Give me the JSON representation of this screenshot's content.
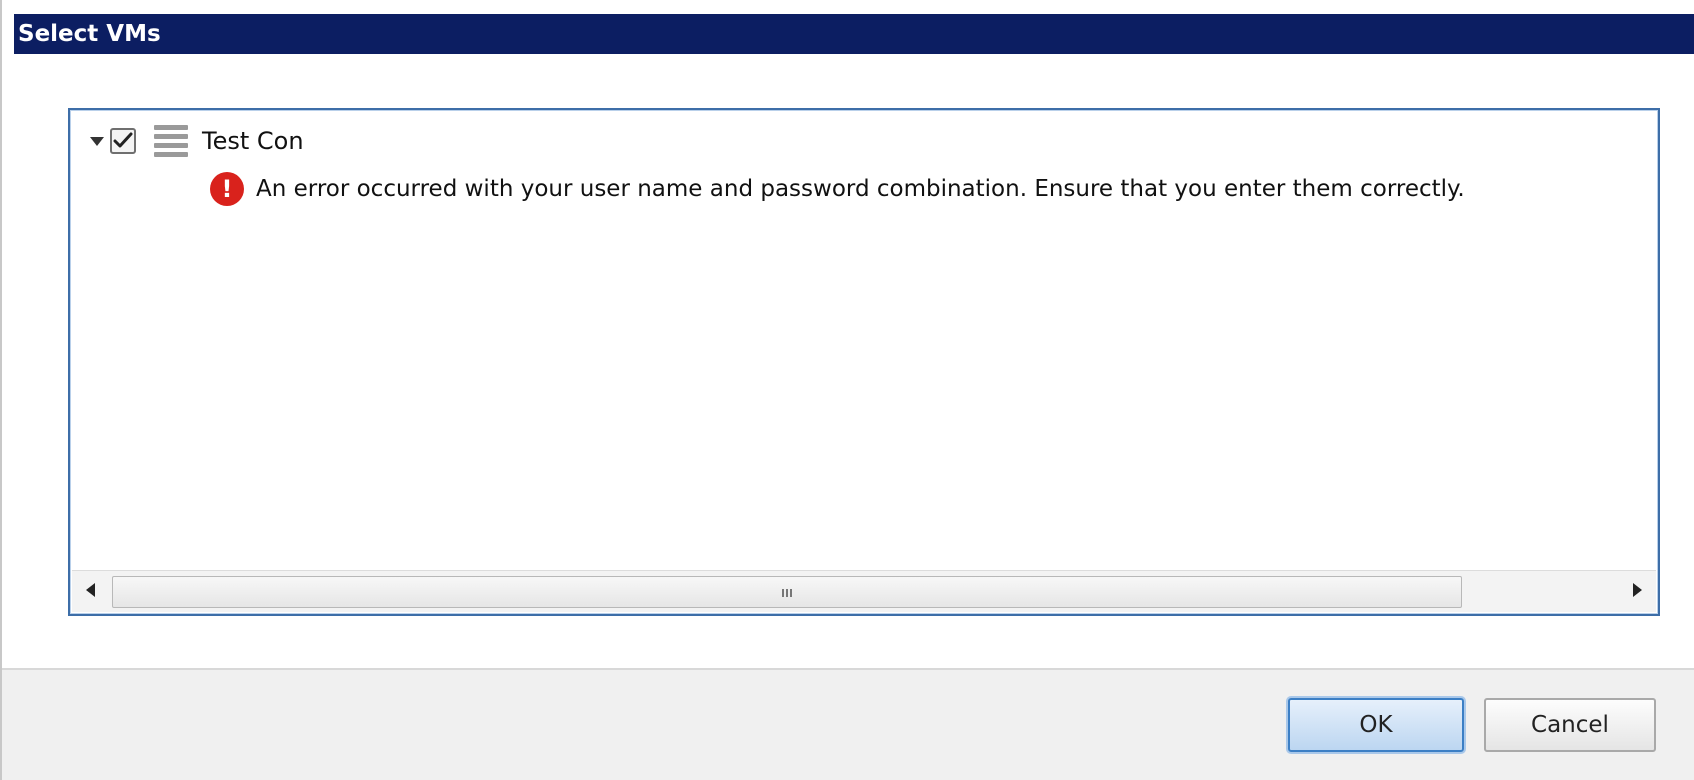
{
  "dialog": {
    "title": "Select VMs"
  },
  "tree": {
    "items": [
      {
        "label": "Test Con",
        "checked": true,
        "expanded": true,
        "icon": "server-icon",
        "error": {
          "icon": "error-icon",
          "icon_glyph": "!",
          "message": "An error occurred with your user name and password combination. Ensure that you enter them correctly."
        }
      }
    ]
  },
  "scrollbar": {
    "grip_glyph": "III"
  },
  "buttons": {
    "ok_label": "OK",
    "cancel_label": "Cancel"
  },
  "colors": {
    "title_bar": "#0c1e62",
    "error": "#d9221c",
    "accent_border": "#3d6ea8"
  }
}
